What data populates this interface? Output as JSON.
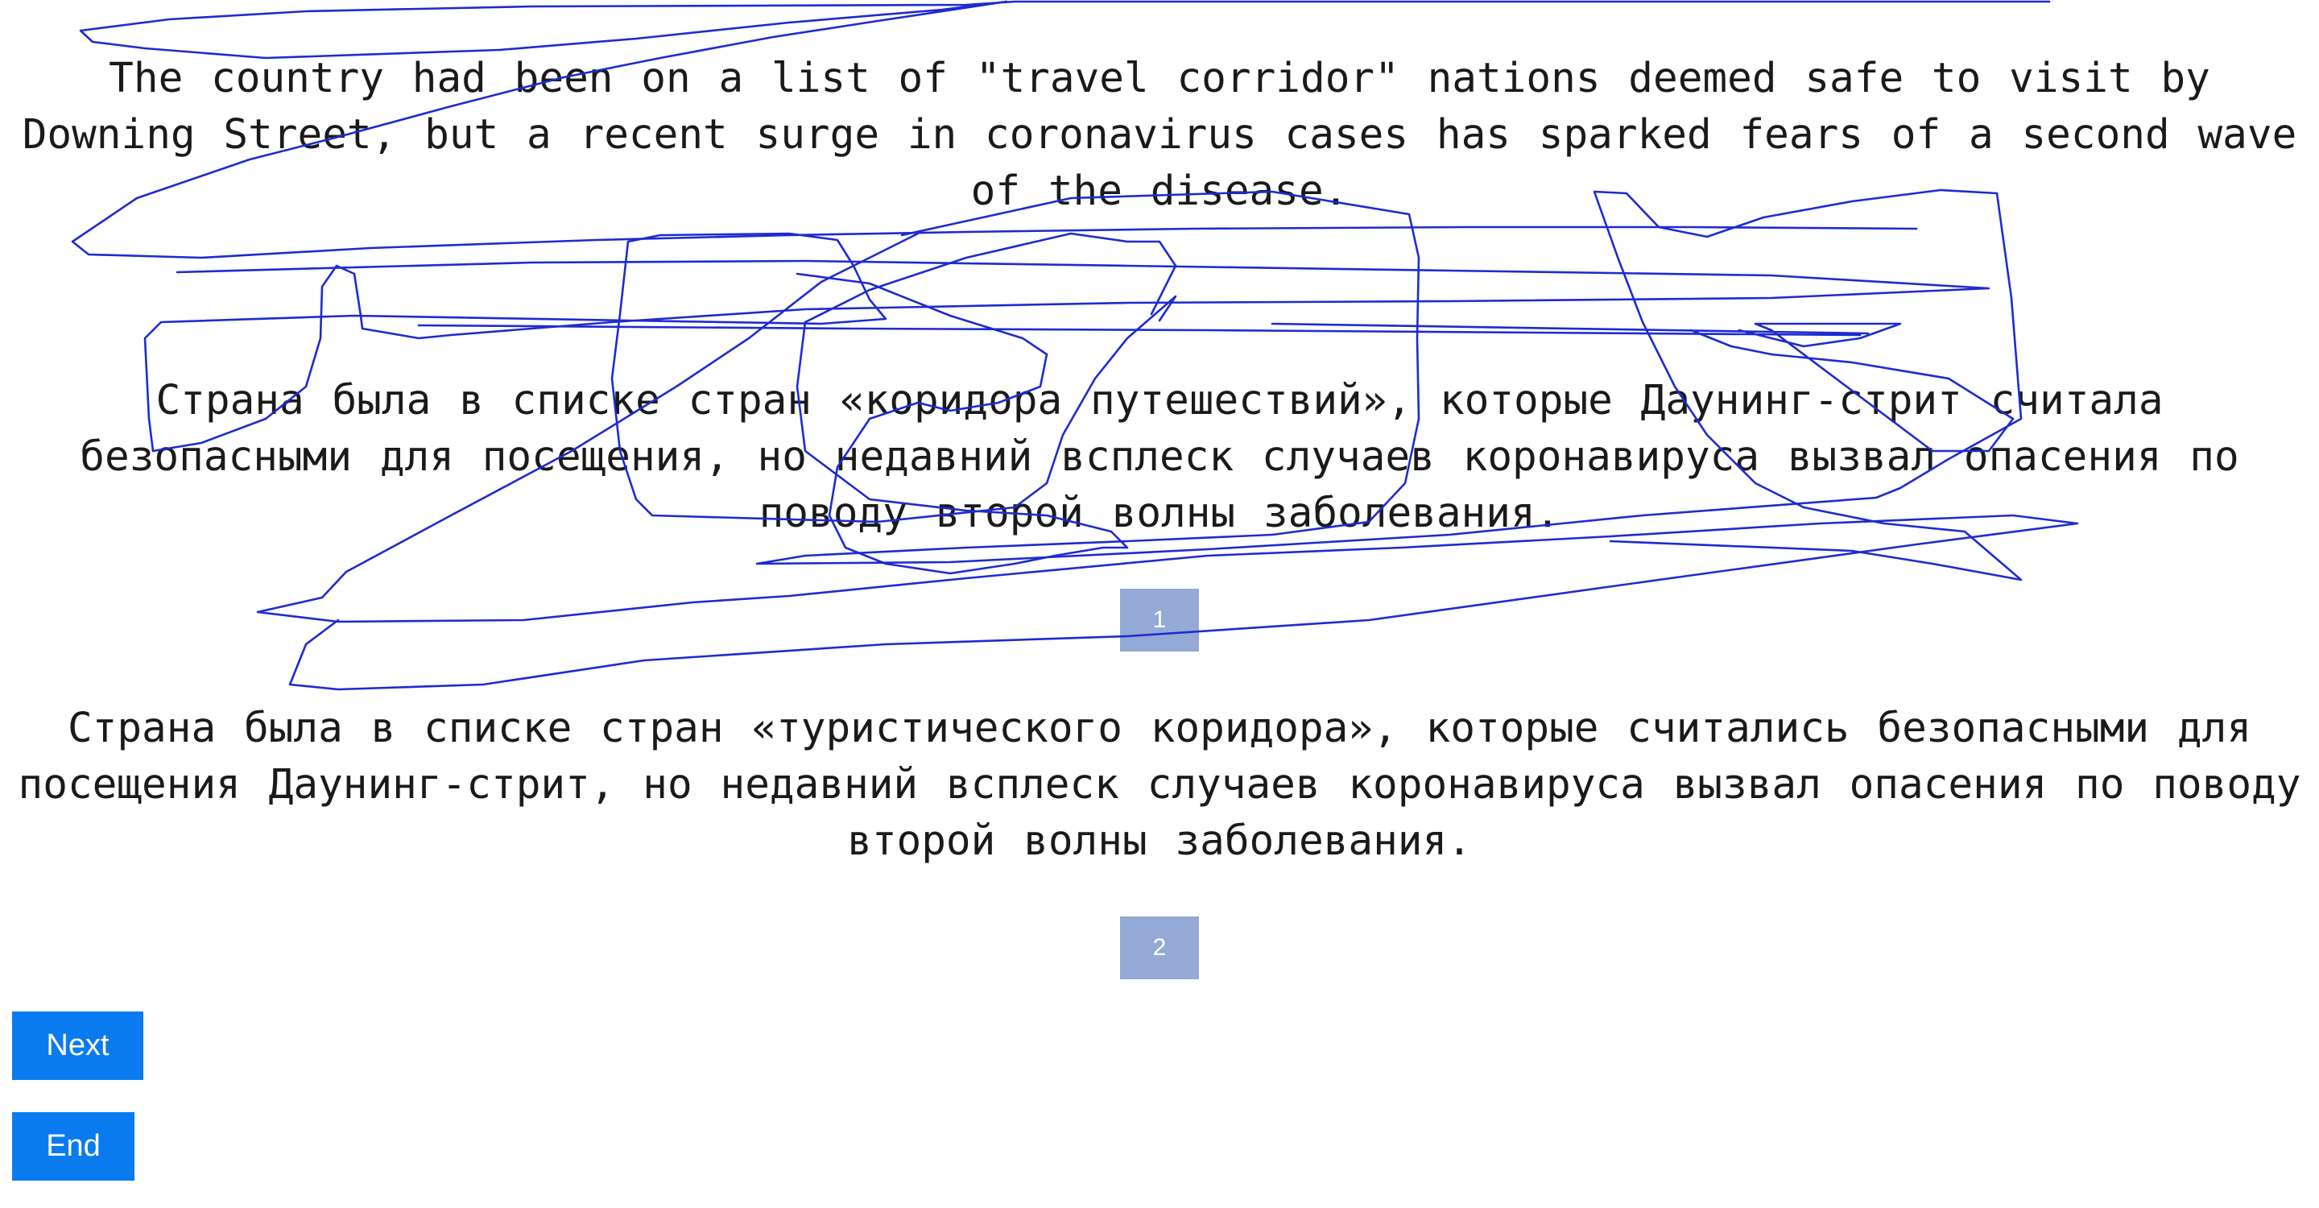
{
  "source": {
    "text": "The country had been on a list of \"travel corridor\" nations deemed safe to visit by Downing Street, but a recent surge in coronavirus cases has sparked fears of a second wave of the disease."
  },
  "translations": [
    {
      "text": "Страна была в списке стран «коридора путешествий», которые Даунинг-стрит считала безопасными для посещения, но недавний всплеск случаев коронавируса вызвал опасения по поводу второй волны заболевания.",
      "badge": "1"
    },
    {
      "text": "Страна была в списке стран «туристического коридора», которые считались безопасными для посещения Даунинг-стрит, но недавний всплеск случаев коронавируса вызвал опасения по поводу второй волны заболевания.",
      "badge": "2"
    }
  ],
  "buttons": {
    "next": "Next",
    "end": "End"
  },
  "colors": {
    "scribble": "#1d2bd0",
    "badge": "#94a9d6",
    "button": "#0a7bef"
  }
}
